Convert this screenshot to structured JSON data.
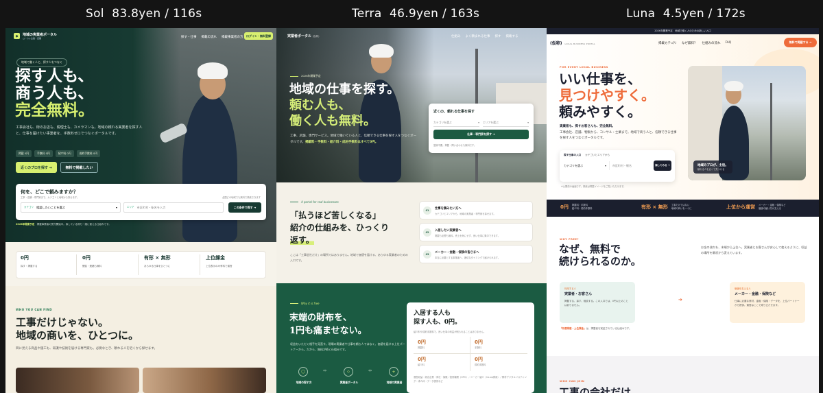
{
  "labels": [
    {
      "name": "Sol",
      "price": "83.8yen",
      "time": "116s"
    },
    {
      "name": "Terra",
      "price": "46.9yen",
      "time": "163s"
    },
    {
      "name": "Luna",
      "price": "4.5yen",
      "time": "172s"
    }
  ],
  "sol": {
    "brand": "地域の実業者ポータル",
    "brand_sub": "ローカル企業・店舗",
    "nav": [
      "探す・仕事",
      "掲載の流れ",
      "掲載事業者の方"
    ],
    "nav_button": "ログイン・無料登録",
    "pill": "地域で働く人と、探す人をつなぐ",
    "headline": [
      "探す人も、",
      "商う人も、",
      "完全無料。"
    ],
    "desc": "工事会社も、街のお店も、税理士も、カメラマンも。地域の頼れる実業者を探す人と、仕事を届けたい事業者を、手数料ゼロでつなぐポータルです。",
    "tags": [
      "掲載 0円",
      "手数料 0円",
      "紹介料 0円",
      "成約手数料 0円"
    ],
    "btn_primary": "近くのプロを探す ➔",
    "btn_secondary": "無料で掲載したい",
    "search_title": "何を、どこで頼みますか？",
    "search_sub": "工事・店舗・専門家まで、カテゴリと地域から探せます。",
    "search_note": "全国どの地域でも無料で検索できます",
    "category_label": "カテゴリ",
    "category_value": "相談したいことを選ぶ",
    "area_label": "エリア",
    "area_placeholder": "市区町村・駅名を入力",
    "search_button": "この条件で探す ➔",
    "footnote_bold": "2026年開業予定",
    "footnote": "掲載事業者の受付開始中。探している側も一緒に使える仕組みです。",
    "stats": [
      {
        "value": "0円",
        "sub": "探す・掲載する"
      },
      {
        "value": "0円",
        "sub": "閲覧・連絡も無料"
      },
      {
        "value": "有形 × 無形",
        "sub": "あらゆる仕事をひとつに"
      },
      {
        "value": "上位課金",
        "sub": "上位表示のみ有料で運営"
      }
    ],
    "who_label": "WHO YOU CAN FIND",
    "section_title": [
      "工事だけじゃない。",
      "地域の商いを、ひとつに。"
    ],
    "section_desc": "目に見える商品や施工も、知識や技術を届ける専門家も。必要なとき、頼れる人を近くから探せます。"
  },
  "terra": {
    "brand": "実業者ポータル",
    "brand_tag": "(仮称)",
    "nav": [
      "仕組み",
      "よく頼まれる仕事",
      "探す",
      "掲載する"
    ],
    "badge": "2026年開業予定",
    "headline": [
      "地域の仕事を探す。",
      "頼む人も、",
      "働く人も無料。"
    ],
    "desc": "工事、店舗、専門サービス。地域で働いている人と、信頼できる仕事を探す人をつなぐポータルです。",
    "desc_highlight": "掲載料・手数料・紹介料・成約手数料はすべて0円。",
    "card_title": "近くの、頼れる仕事を探す",
    "card_select1": "カテゴリを選ぶ",
    "card_select2": "エリアを選ぶ",
    "card_button": "仕事・専門家を探す ➔",
    "card_note": "登録不要。掲載・問い合わせも無料です。",
    "portal_label": "A portal for real businesses",
    "quote": [
      "「払うほど苦しくなる」",
      "紹介の仕組みを、ひっくり",
      "返す。"
    ],
    "quote_desc": "ここは「工事会社だけ」の場所ではありません。地域で価値を届ける、あらゆる実業者のための入口です。",
    "steps": [
      {
        "num": "01",
        "title": "仕事を頼みたい方へ",
        "sub": "カテゴリとエリアから、地域の実業者・専門家を探せます。"
      },
      {
        "num": "02",
        "title": "入居したい実業者へ",
        "sub": "掲載も反響も無料。売上を気にせず、良い仕事に集中できます。"
      },
      {
        "num": "03",
        "title": "メーカー・金融・保険の皆さまへ",
        "sub": "本当に必要とする事業者へ、適切なタイミングで届けられます。"
      }
    ],
    "why_label": "Why it is free",
    "green_title": [
      "末端の財布を、",
      "1円も痛ませない。"
    ],
    "green_desc": "収益をいただく相手を見直す。現場の実業者や仕事を頼む人ではなく、価値を届ける上位パートナーから。だから、無料が続く仕組みです。",
    "flow": [
      "地域の探す方",
      "実業者ポータル",
      "地域の実業者"
    ],
    "flow_arrow": "⇔",
    "white_title": [
      "入居する人も",
      "探す人も、0円。"
    ],
    "white_sub": "紹介料や成約手数料で、良い仕事の利益が削られることはありません。",
    "grid": [
      {
        "value": "0円",
        "sub": "掲載料"
      },
      {
        "value": "0円",
        "sub": "手数料"
      },
      {
        "value": "0円",
        "sub": "紹介料"
      },
      {
        "value": "0円",
        "sub": "成約手数料"
      }
    ],
    "white_foot": "運営収益：総合企業・商社・保険／投資機関（OPO）／メーカー紹介（Co-op費用）／教材デジタルリスティング・求人枠・データ提供など"
  },
  "luna": {
    "topbar": "2026年開業予定　地域で働く人のための新しい入口",
    "logo": "(仮称)",
    "logo_sub": "LOCAL BUSINESS PORTAL",
    "nav": [
      "掲載カテゴリ",
      "なぜ無料？",
      "仕組みの流れ",
      "FAQ"
    ],
    "nav_button": "無料で掲載する ➔",
    "eyebrow": "FOR EVERY LOCAL BUSINESS",
    "headline": [
      "いい仕事を、",
      "見つけやすく。",
      "頼みやすく。"
    ],
    "desc_bold": "実業者も、探すお客さんも、完全無料。",
    "desc": "工事会社、店舗、物販から、コンサル・士業まで。地域で商う人と、信頼できる仕事を探す人をつなぐポータルです。",
    "search_label1": "探す仕事の入口",
    "search_label2": "カテゴリとエリアから",
    "search_select": "カテゴリを選ぶ",
    "search_input": "市区町村・駅名",
    "search_button": "探してみる ➔",
    "search_note": "※公開前の画面です。検索は掲載イメージをご覧いただけます。",
    "photo_caption": [
      "地域のプロが、主役。",
      "頼れる人を近くで見つける"
    ],
    "stats": [
      {
        "value": "0円",
        "sub": "掲載料・手数料\n紹介料・成約手数料"
      },
      {
        "value": "有形 × 無形",
        "sub": "工事だけではない\n地域の商いを一つに"
      },
      {
        "value": "上位から運営",
        "sub": "メーカー・金融・保険など\n価値の届け先が支える"
      }
    ],
    "why_label": "WHY FREE?",
    "why_title": [
      "なぜ、無料で",
      "続けられるのか。"
    ],
    "why_desc": "お金の流れを、末端から上位へ。実業者とお客さんが安心して使えるように、収益の場所を最初から変えています。",
    "box1_label": "利用する人",
    "box1_title": "実業者・お客さん",
    "box1_desc": "掲載する、探す、相談する。この入口では、0円以上のことはありません。",
    "arrow": "➔",
    "box2_label": "価値を支える人",
    "box2_title": "メーカー・金融・保険など",
    "box2_desc": "仕事に必要な資材、金融・保険・データを、上位パートナーから提供。運営はここで成り立たせます。",
    "note_highlight": "「有償掲載・上位課金」",
    "note": "は、掲載者を実証されている仕組みです。",
    "can_join": "WHO CAN JOIN",
    "bottom_title": "工事の会社だけ"
  }
}
